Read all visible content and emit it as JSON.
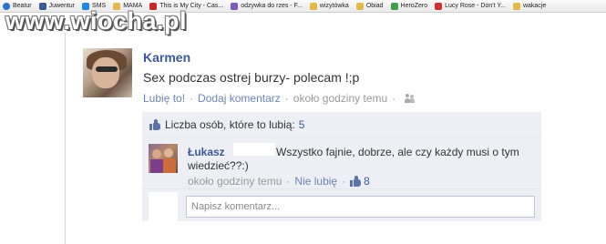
{
  "bookmarks": [
    {
      "label": "Beatur",
      "icon": "globe-icon",
      "color": "#2a73c9"
    },
    {
      "label": "Juwentur",
      "icon": "facebook-icon",
      "color": "#3b5998"
    },
    {
      "label": "SMS",
      "icon": "mail-icon",
      "color": "#1e88e5"
    },
    {
      "label": "MAMA",
      "icon": "folder-icon",
      "color": "#e6b84c"
    },
    {
      "label": "This is My City - Cas...",
      "icon": "page-icon",
      "color": "#c62828"
    },
    {
      "label": "odzywka do rzes - F...",
      "icon": "page-icon",
      "color": "#7e57c2"
    },
    {
      "label": "wizytówka",
      "icon": "folder-icon",
      "color": "#e6b84c"
    },
    {
      "label": "Obiad",
      "icon": "folder-icon",
      "color": "#e6b84c"
    },
    {
      "label": "HeroZero",
      "icon": "page-icon",
      "color": "#43a047"
    },
    {
      "label": "Lucy Rose - Don't Y...",
      "icon": "youtube-icon",
      "color": "#d32f2f"
    },
    {
      "label": "wakacje",
      "icon": "folder-icon",
      "color": "#e6b84c"
    }
  ],
  "watermark": "www.wiocha.pl",
  "post": {
    "author": "Karmen",
    "text": "Sex podczas ostrej burzy- polecam !;p",
    "like_link": "Lubię to!",
    "comment_link": "Dodaj komentarz",
    "time": "około godziny temu",
    "sep": "·"
  },
  "likes": {
    "label": "Liczba osób, które to lubią:",
    "count": "5"
  },
  "comment": {
    "author": "Łukasz",
    "text_line1": "Wszystko fajnie, dobrze, ale czy każdy musi o tym",
    "text_line2": "wiedzieć??:)",
    "time": "około godziny temu",
    "unlike_link": "Nie lubię",
    "like_count": "8",
    "sep": "·"
  },
  "write": {
    "placeholder": "Napisz komentarz..."
  }
}
